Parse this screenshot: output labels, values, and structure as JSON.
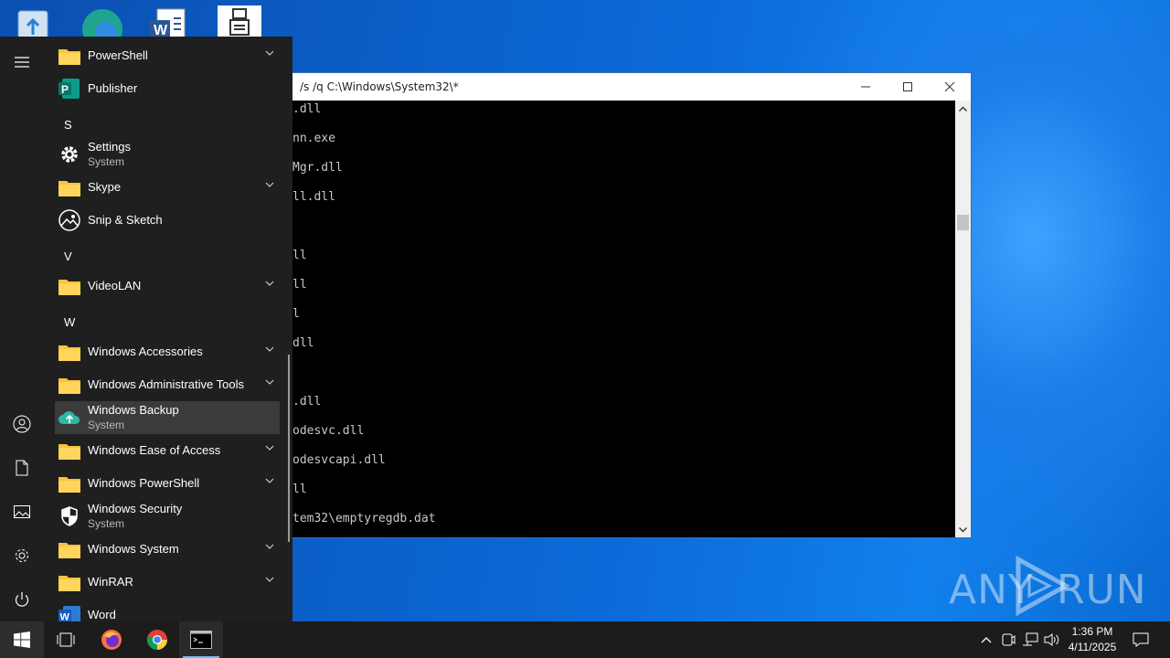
{
  "console": {
    "title": "/s /q C:\\Windows\\System32\\*",
    "lines": [
      ".dll",
      "nn.exe",
      "Mgr.dll",
      "ll.dll",
      "ll",
      "ll",
      "l",
      "dll",
      ".dll",
      "odesvc.dll",
      "odesvcapi.dll",
      "ll",
      "tem32\\emptyregdb.dat"
    ]
  },
  "start_menu": {
    "rail": [
      "menu-icon",
      "user-icon",
      "document-icon",
      "pictures-icon",
      "settings-icon",
      "power-icon"
    ],
    "items": {
      "powershell": "PowerShell",
      "publisher": "Publisher",
      "letter_s": "S",
      "settings": "Settings",
      "settings_sub": "System",
      "skype": "Skype",
      "snip": "Snip & Sketch",
      "letter_v": "V",
      "videolan": "VideoLAN",
      "letter_w": "W",
      "accessories": "Windows Accessories",
      "admin_tools": "Windows Administrative Tools",
      "backup": "Windows Backup",
      "backup_sub": "System",
      "ease": "Windows Ease of Access",
      "win_powershell": "Windows PowerShell",
      "security": "Windows Security",
      "security_sub": "System",
      "win_system": "Windows System",
      "winrar": "WinRAR",
      "word": "Word"
    }
  },
  "taskbar": {
    "time": "1:36 PM",
    "date": "4/11/2025"
  },
  "watermark": {
    "left": "ANY",
    "right": "RUN"
  },
  "colors": {
    "accent": "#76b9ed",
    "folder": "#f8c43a",
    "menu_bg": "#1f1f1f"
  }
}
